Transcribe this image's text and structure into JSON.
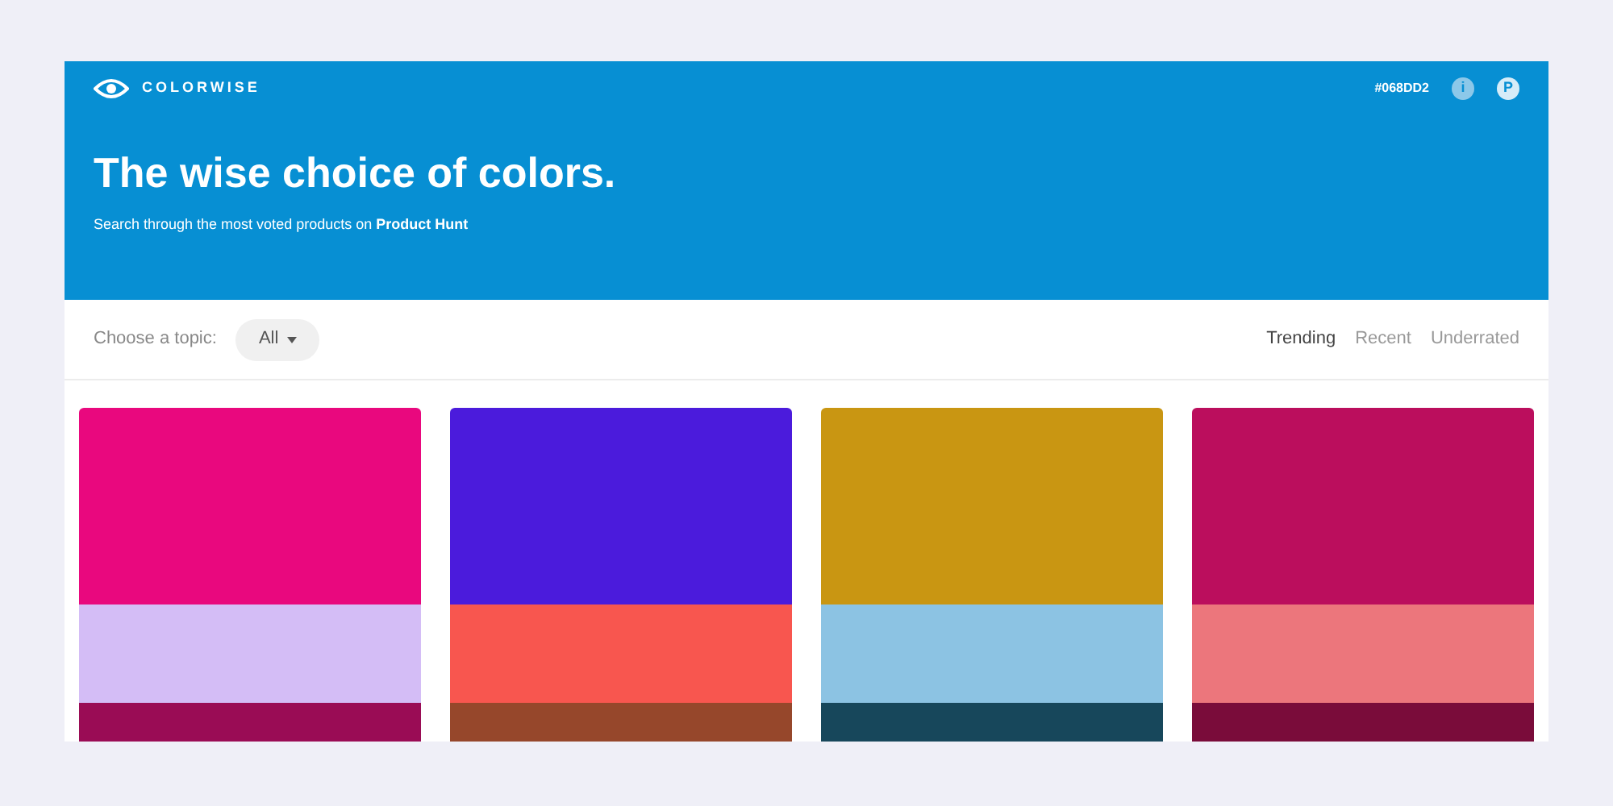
{
  "header": {
    "brand": "COLORWISE",
    "hex": "#068DD2",
    "info_icon": "i",
    "profile_icon": "P",
    "title": "The wise choice of colors.",
    "subtitle_prefix": "Search through the most voted products on ",
    "subtitle_link": "Product Hunt"
  },
  "filter": {
    "label": "Choose a topic:",
    "topic": "All"
  },
  "sort_tabs": [
    {
      "label": "Trending",
      "selected": true
    },
    {
      "label": "Recent",
      "selected": false
    },
    {
      "label": "Underrated",
      "selected": false
    }
  ],
  "palettes": [
    {
      "swatches": [
        {
          "color": "#e9087e"
        },
        {
          "color": "#d4bdf6"
        },
        {
          "color": "#9a0c55"
        }
      ]
    },
    {
      "swatches": [
        {
          "color": "#4b1bdc"
        },
        {
          "color": "#f8564f"
        },
        {
          "color": "#96472b"
        }
      ]
    },
    {
      "swatches": [
        {
          "color": "#c99612"
        },
        {
          "color": "#8cc3e3"
        },
        {
          "color": "#17475b"
        }
      ]
    },
    {
      "swatches": [
        {
          "color": "#bb0e5d"
        },
        {
          "color": "#ec767c"
        },
        {
          "color": "#7a0c3a"
        }
      ]
    }
  ]
}
